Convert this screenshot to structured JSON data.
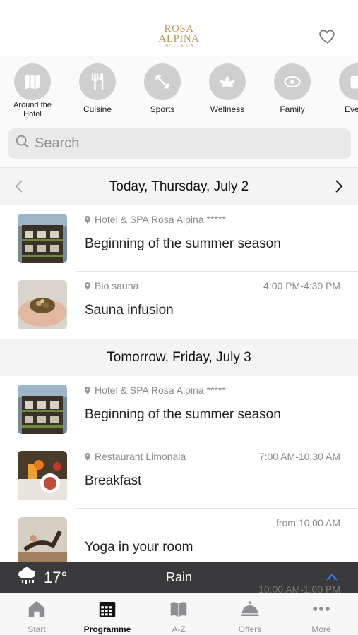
{
  "header": {
    "logo_line1": "ROSA",
    "logo_line2": "ALPINA",
    "logo_line3": "HOTEL & SPA",
    "logo_color": "#b59a5b"
  },
  "categories": [
    {
      "label": "Around the Hotel",
      "icon": "map-icon"
    },
    {
      "label": "Cuisine",
      "icon": "fork-knife-icon"
    },
    {
      "label": "Sports",
      "icon": "arrows-icon"
    },
    {
      "label": "Wellness",
      "icon": "lotus-icon"
    },
    {
      "label": "Family",
      "icon": "pacifier-icon"
    },
    {
      "label": "Eve",
      "icon": "calendar-icon"
    }
  ],
  "search": {
    "placeholder": "Search"
  },
  "days": [
    {
      "label": "Today, Thursday, July 2",
      "events": [
        {
          "location": "Hotel & SPA Rosa Alpina *****",
          "time": "",
          "title": "Beginning of the summer season"
        },
        {
          "location": "Bio sauna",
          "time": "4:00 PM-4:30 PM",
          "title": "Sauna infusion"
        }
      ]
    },
    {
      "label": "Tomorrow, Friday, July 3",
      "events": [
        {
          "location": "Hotel & SPA Rosa Alpina *****",
          "time": "",
          "title": "Beginning of the summer season"
        },
        {
          "location": "Restaurant Limonaia",
          "time": "7:00 AM-10:30 AM",
          "title": "Breakfast"
        },
        {
          "location": "",
          "time": "from 10:00 AM",
          "title": "Yoga in your room"
        }
      ]
    }
  ],
  "weather": {
    "temperature": "17°",
    "condition": "Rain",
    "next_time": "10:00 AM-1:00 PM"
  },
  "tabs": [
    {
      "label": "Start",
      "icon": "home-icon",
      "active": false
    },
    {
      "label": "Programme",
      "icon": "calendar-grid-icon",
      "active": true
    },
    {
      "label": "A-Z",
      "icon": "book-icon",
      "active": false
    },
    {
      "label": "Offers",
      "icon": "cloche-icon",
      "active": false
    },
    {
      "label": "More",
      "icon": "more-dots-icon",
      "active": false
    }
  ],
  "colors": {
    "accent": "#2f80ed",
    "weather_bar": "#3a3a3c",
    "icon_gray": "#cfcfcf"
  }
}
